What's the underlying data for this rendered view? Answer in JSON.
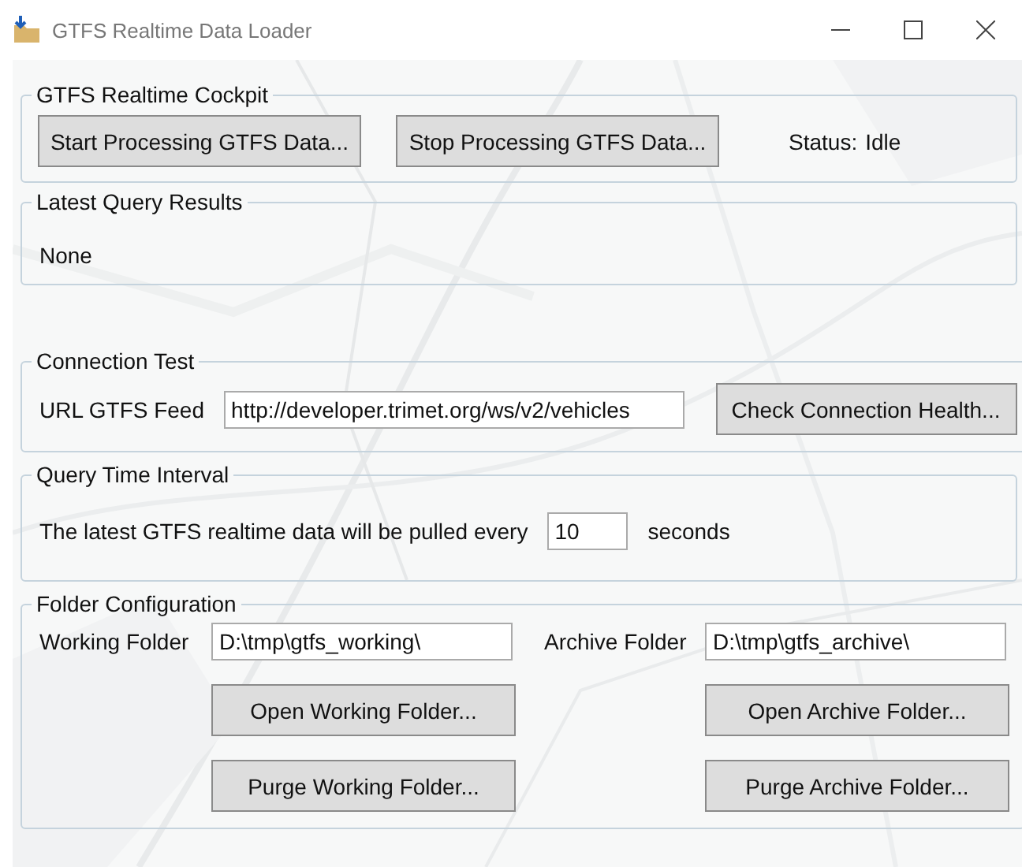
{
  "window": {
    "title": "GTFS Realtime Data Loader"
  },
  "cockpit": {
    "title": "GTFS Realtime Cockpit",
    "buttons": [
      "Start Processing GTFS Data...",
      "Stop Processing GTFS Data..."
    ],
    "status_label": "Status:",
    "status": "Idle"
  },
  "latest_query_results": {
    "title": "Latest Query Results",
    "text": "None"
  },
  "connection_test": {
    "title": "Connection Test",
    "label": "URL GTFS Feed",
    "value": "http://developer.trimet.org/ws/v2/vehicles",
    "button": "Check Connection Health..."
  },
  "query_time_interval": {
    "title": "Query Time Interval",
    "label": "The latest GTFS realtime data will be pulled every",
    "value": "10",
    "unit": "seconds"
  },
  "folder_configuration": {
    "title": "Folder Configuration",
    "folders": [
      {
        "label": "Working Folder",
        "value": "D:\\tmp\\gtfs_working\\",
        "open_button": "Open Working Folder...",
        "purge_button": "Purge Working Folder..."
      },
      {
        "label": "Archive Folder",
        "value": "D:\\tmp\\gtfs_archive\\",
        "open_button": "Open Archive Folder...",
        "purge_button": "Purge Archive Folder..."
      }
    ]
  }
}
